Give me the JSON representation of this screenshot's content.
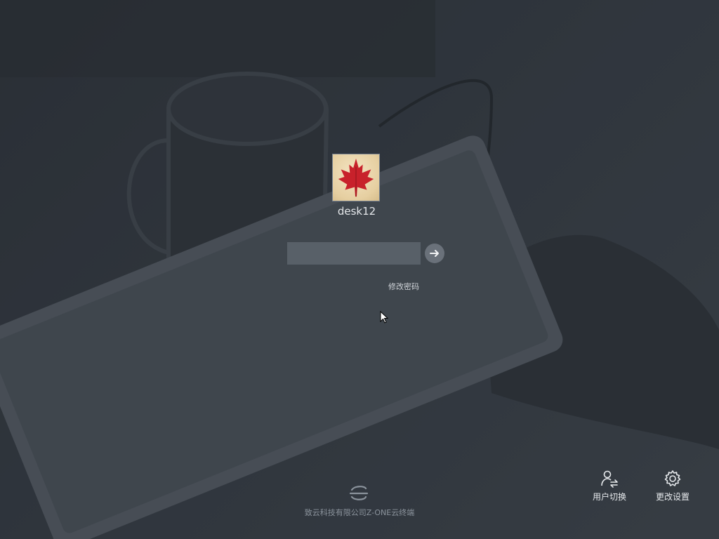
{
  "login": {
    "username": "desk12",
    "password": {
      "value": "",
      "placeholder": ""
    },
    "change_password_label": "修改密码"
  },
  "footer": {
    "company_text": "致云科技有限公司Z-ONE云终端"
  },
  "actions": {
    "user_switch_label": "用户切换",
    "settings_label": "更改设置"
  },
  "icons": {
    "avatar": "maple-leaf",
    "submit": "arrow-right-icon",
    "user_switch": "user-switch-icon",
    "settings": "gear-icon",
    "logo": "zone-logo-icon",
    "cursor": "mouse-pointer"
  },
  "colors": {
    "background": "#323840",
    "input_background": "#5e656e",
    "submit_button": "#6a717a",
    "text_primary": "#e4e7ea",
    "text_muted": "#8b939c",
    "leaf": "#c8212b"
  }
}
